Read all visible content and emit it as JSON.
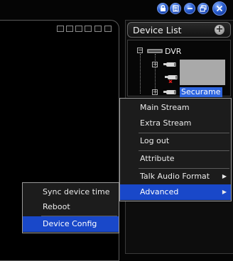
{
  "device_list": {
    "title": "Device List",
    "add_symbol": "+",
    "tree": {
      "root_label": "DVR",
      "selected_label": "Securame"
    }
  },
  "context_menu": {
    "items": [
      {
        "label": "Main Stream"
      },
      {
        "label": "Extra Stream"
      },
      {
        "label": "Log out"
      },
      {
        "label": "Attribute"
      },
      {
        "label": "Talk Audio Format"
      },
      {
        "label": "Advanced"
      }
    ]
  },
  "submenu": {
    "items": [
      {
        "label": "Sync device time"
      },
      {
        "label": "Reboot"
      },
      {
        "label": "Device Config"
      }
    ]
  },
  "colors": {
    "highlight": "#1948c9",
    "window_button": "#2b5fd0",
    "selection": "#2f66e0"
  }
}
